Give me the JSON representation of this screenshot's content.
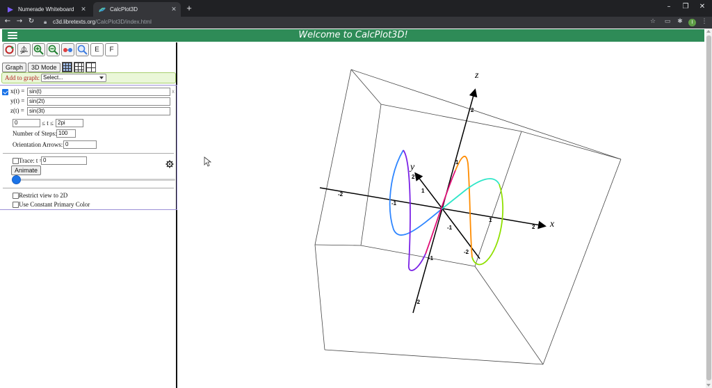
{
  "browser": {
    "tabs": [
      {
        "title": "Numerade Whiteboard",
        "active": false
      },
      {
        "title": "CalcPlot3D",
        "active": true
      }
    ],
    "new_tab": "+",
    "window_controls": [
      "–",
      "❐",
      "✕"
    ],
    "url_host": "c3d.libretexts.org",
    "url_path": "/CalcPlot3D/index.html",
    "profile_initial": "I",
    "tab_close": "✕",
    "nav_icons": [
      "back-arrow-icon",
      "forward-arrow-icon",
      "reload-icon"
    ],
    "toolbar_icons": [
      "bookmark-star-icon",
      "cast-icon",
      "extensions-icon",
      "profile-icon",
      "menu-kebab-icon"
    ]
  },
  "header": {
    "title": "Welcome to CalcPlot3D!",
    "color": "#2e8b57"
  },
  "toolbar": {
    "icons": [
      "rotate-icon",
      "axes-icon",
      "zoom-in-icon",
      "zoom-out-icon",
      "glasses-icon",
      "zoom-box-icon"
    ],
    "letter_buttons": [
      "E",
      "F"
    ],
    "graph_label": "Graph",
    "mode_label": "3D Mode",
    "grid_icons": [
      "grid-small-icon",
      "grid-medium-icon",
      "grid-large-icon"
    ]
  },
  "add_bar": {
    "label": "Add to graph:",
    "select_value": "Select..."
  },
  "curve": {
    "x_label": "x(t) =",
    "y_label": "y(t) =",
    "z_label": "z(t) =",
    "x_expr": "sin(t)",
    "y_expr": "sin(2t)",
    "z_expr": "sin(3t)",
    "close": "x",
    "t_min": "0",
    "t_max": "2pi",
    "t_range_label": "≤ t ≤",
    "steps_label": "Number of Steps:",
    "steps": "100",
    "arrows_label": "Orientation Arrows:",
    "arrows": "0",
    "trace_label": "Trace: t =",
    "trace_value": "0",
    "animate_label": "Animate",
    "restrict_label": "Restrict view to 2D",
    "constant_color_label": "Use Constant Primary Color"
  },
  "plot": {
    "axis_labels": {
      "x": "x",
      "y": "y",
      "z": "z"
    },
    "tick_labels": {
      "x_neg2": "-2",
      "x_neg1": "-1",
      "x_1": "1",
      "x_2": "2",
      "y_2": "2",
      "y_1": "1",
      "y_neg1": "-1",
      "y_neg2": "-2",
      "z_2": "2",
      "z_1": "1",
      "z_neg1": "-1",
      "z_neg2": "-2"
    }
  }
}
